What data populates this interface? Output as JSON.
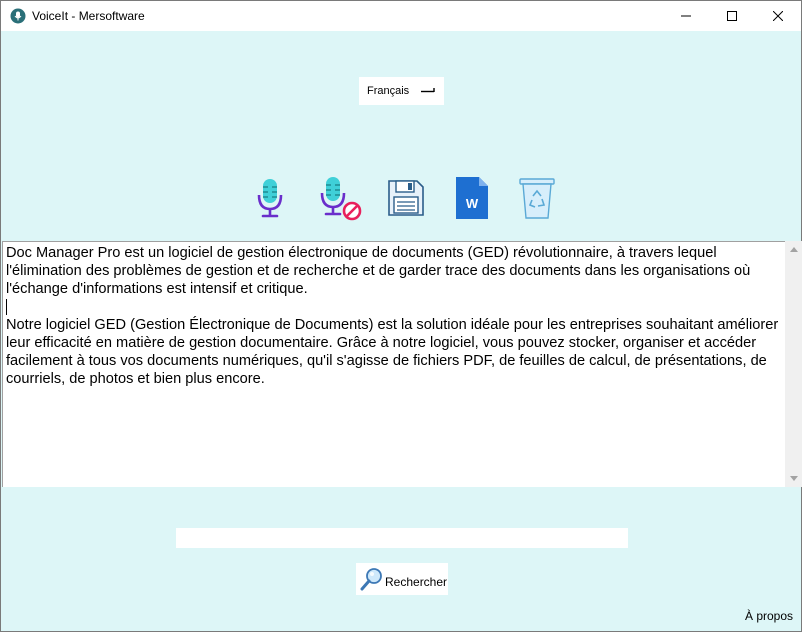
{
  "window": {
    "title": "VoiceIt - Mersoftware"
  },
  "language": {
    "selected": "Français"
  },
  "toolbar": {
    "icons": [
      "microphone-icon",
      "microphone-off-icon",
      "floppy-save-icon",
      "word-document-icon",
      "recycle-bin-icon"
    ],
    "word_letter": "W"
  },
  "editor": {
    "paragraphs": [
      "Doc Manager Pro est un logiciel de gestion électronique de documents (GED) révolutionnaire, à travers lequel l'élimination des problèmes de gestion et de recherche et de garder trace des documents dans les organisations où l'échange d'informations est intensif et critique.",
      "Notre logiciel GED (Gestion Électronique de Documents) est la solution idéale pour les entreprises souhaitant améliorer leur efficacité en matière de gestion documentaire. Grâce à notre logiciel, vous pouvez stocker, organiser et accéder facilement à tous vos documents numériques, qu'il s'agisse de fichiers PDF, de feuilles de calcul, de présentations, de courriels, de photos et bien plus encore."
    ]
  },
  "search": {
    "value": "",
    "button_label": "Rechercher"
  },
  "footer": {
    "about_label": "À propos"
  },
  "colors": {
    "background": "#ddf6f7",
    "mic_teal": "#3fd0d8",
    "mic_purple": "#6a2ecb",
    "word_blue": "#1e6fd1"
  }
}
